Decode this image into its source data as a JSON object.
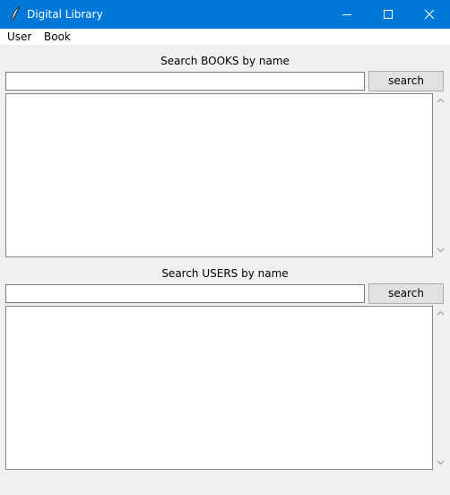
{
  "window": {
    "title": "Digital Library",
    "icon": "feather-icon",
    "controls": [
      "minimize-icon",
      "maximize-icon",
      "close-icon"
    ],
    "titlebar_color": "#0078d7"
  },
  "menubar": {
    "items": [
      {
        "label": "User"
      },
      {
        "label": "Book"
      }
    ]
  },
  "books_section": {
    "label": "Search BOOKS by name",
    "input_value": "",
    "button_label": "search",
    "results": []
  },
  "users_section": {
    "label": "Search USERS by name",
    "input_value": "",
    "button_label": "search",
    "results": []
  }
}
